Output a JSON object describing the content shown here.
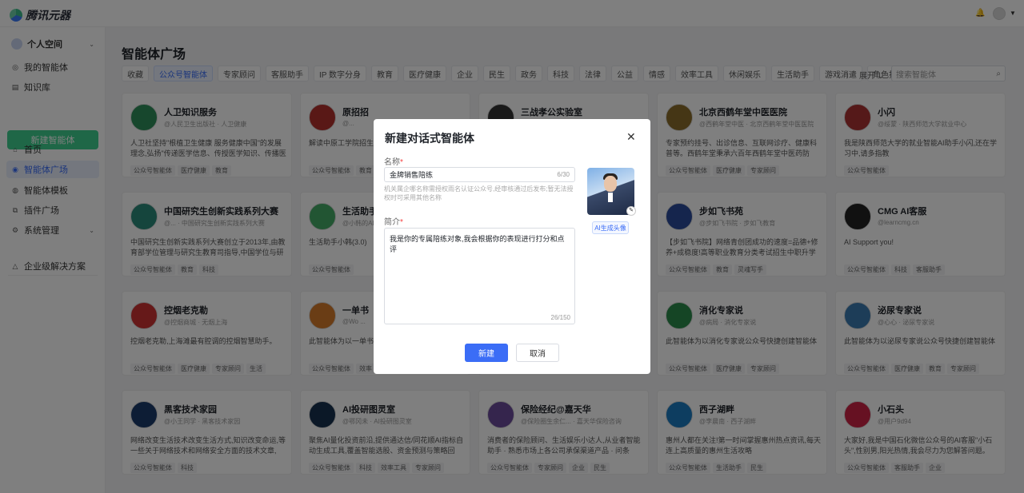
{
  "app": {
    "name": "腾讯元器"
  },
  "sidebar": {
    "workspace": "个人空间",
    "items": [
      {
        "label": "我的智能体"
      },
      {
        "label": "知识库"
      },
      {
        "label": "首页"
      },
      {
        "label": "智能体广场"
      },
      {
        "label": "智能体模板"
      },
      {
        "label": "插件广场"
      },
      {
        "label": "系统管理"
      },
      {
        "label": "企业级解决方案"
      }
    ],
    "new_agent_label": "新建智能体"
  },
  "main": {
    "title": "智能体广场",
    "tags": [
      "收藏",
      "公众号智能体",
      "专家顾问",
      "客服助手",
      "IP 数字分身",
      "教育",
      "医疗健康",
      "企业",
      "民生",
      "政务",
      "科技",
      "法律",
      "公益",
      "情感",
      "效率工具",
      "休闲娱乐",
      "生活助手",
      "游戏消遣",
      "角色扮演"
    ],
    "active_tag": "公众号智能体",
    "expand_label": "展开",
    "search_placeholder": "搜索智能体"
  },
  "cards": [
    {
      "name": "人卫知识服务",
      "meta": "@人民卫生出版社 · 人卫健康",
      "desc": "人卫社坚持\"根植卫生健康 服务健康中国\"的发展理念,弘扬\"传递医学信息、传授医学知识、传播医学...",
      "tags": [
        "公众号智能体",
        "医疗健康",
        "教育"
      ]
    },
    {
      "name": "原招招",
      "meta": "@...",
      "desc": "解读中原工学院招生政策...",
      "tags": [
        "公众号智能体",
        "教育"
      ]
    },
    {
      "name": "三战孝公实验室",
      "meta": "",
      "desc": "",
      "tags": []
    },
    {
      "name": "北京西鹤年堂中医医院",
      "meta": "@西鹤年堂中医 · 北京西鹤年堂中医医院",
      "desc": "专家预约挂号、出诊信息、互联网诊疗、健康科普等。西鹤年堂秉承六百年西鹤年堂中医药防病、治...",
      "tags": [
        "公众号智能体",
        "医疗健康",
        "专家顾问"
      ]
    },
    {
      "name": "小闪",
      "meta": "@绥蒙 · 陕西师范大学就业中心",
      "desc": "我是陕西师范大学的就业智能AI助手小闪,还在学习中,请多指教",
      "tags": [
        "公众号智能体"
      ]
    },
    {
      "name": "中国研究生创新实践系列大赛",
      "meta": "@... · 中国研究生创新实践系列大赛",
      "desc": "中国研究生创新实践系列大赛创立于2013年,由教育部学位管理与研究生教育司指导,中国学位与研究生教...",
      "tags": [
        "公众号智能体",
        "教育",
        "科技"
      ]
    },
    {
      "name": "生活助手",
      "meta": "@小韩的AI...",
      "desc": "生活助手小韩(3.0)",
      "tags": [
        "公众号智能体"
      ]
    },
    {
      "name": "",
      "meta": "",
      "desc": "",
      "tags": []
    },
    {
      "name": "步如飞书苑",
      "meta": "@步如飞书院 · 步如飞教育",
      "desc": "【步如飞书院】网络青创团成功的速度=品德+修养+成稳度!高等职业教育分类考试招生中职升学考试...",
      "tags": [
        "公众号智能体",
        "教育",
        "灵魂写手"
      ]
    },
    {
      "name": "CMG AI客服",
      "meta": "@learncmg.cn",
      "desc": "AI Support you!",
      "tags": [
        "公众号智能体",
        "科技",
        "客服助手"
      ]
    },
    {
      "name": "控烟老克勒",
      "meta": "@控烟商城 · 无烟上海",
      "desc": "控烟老克勒,上海滩最有腔调的控烟智慧助手。",
      "tags": [
        "公众号智能体",
        "医疗健康",
        "专家顾问",
        "生活"
      ]
    },
    {
      "name": "一单书",
      "meta": "@Wo ...",
      "desc": "此智能体为以一单书公...",
      "tags": [
        "公众号智能体",
        "效率"
      ]
    },
    {
      "name": "",
      "meta": "",
      "desc": "",
      "tags": []
    },
    {
      "name": "消化专家说",
      "meta": "@病局 · 消化专家说",
      "desc": "此智能体为以消化专家说公众号快捷创建智能体",
      "tags": [
        "公众号智能体",
        "医疗健康",
        "专家顾问"
      ]
    },
    {
      "name": "泌尿专家说",
      "meta": "@心心 · 泌尿专家说",
      "desc": "此智能体为以泌尿专家说公众号快捷创建智能体",
      "tags": [
        "公众号智能体",
        "医疗健康",
        "教育",
        "专家顾问"
      ]
    },
    {
      "name": "黑客技术家园",
      "meta": "@小王同学 · 黑客技术家园",
      "desc": "网络改变生活技术改变生活方式,知识改变命运,等一些关于网络技术和网络安全方面的技术文章,为...",
      "tags": [
        "公众号智能体",
        "科技"
      ]
    },
    {
      "name": "AI投研图灵室",
      "meta": "@鄂冈未 · AI投研图灵室",
      "desc": "聚焦AI量化投资前沿,提供通达信/同花顺AI指标自动生成工具,覆盖智能选股、资金预测与策略回测。...",
      "tags": [
        "公众号智能体",
        "科技",
        "效率工具",
        "专家顾问"
      ]
    },
    {
      "name": "保险经纪@嘉天华",
      "meta": "@保险圈生余仁... · 嘉天华保险咨询",
      "desc": "消费者的保险顾问、生活娱乐小达人,从业者智能助手 · 熟悉市场上各公司承保渠道产品 · 问条款、问评...",
      "tags": [
        "公众号智能体",
        "专家顾问",
        "企业",
        "民生"
      ]
    },
    {
      "name": "西子湖畔",
      "meta": "@李晨南 · 西子湖畔",
      "desc": "惠州人都在关注!第一时间掌握惠州热点资讯,每天连上高质量的惠州生活攻略",
      "tags": [
        "公众号智能体",
        "生活助手",
        "民生"
      ]
    },
    {
      "name": "小石头",
      "meta": "@用户9d94",
      "desc": "大家好,我是中国石化微信公众号的AI客服\"小石头\",性别男,阳光热情,我会尽力为您解答问题。",
      "tags": [
        "公众号智能体",
        "客服助手",
        "企业"
      ]
    }
  ],
  "modal": {
    "title": "新建对话式智能体",
    "name_label": "名称",
    "name_value": "金牌销售陪练",
    "name_count": "6/30",
    "name_hint": "机关属企哪名称需授权雨名认证公众号,经审核通过后发布;暂无法授权时可采用其他名称",
    "ai_avatar_label": "AI生成头像",
    "intro_label": "简介",
    "intro_value": "我是你的专属陪练对象,我会根据你的表现进行打分和点评",
    "intro_count": "26/150",
    "submit_label": "新建",
    "cancel_label": "取消"
  },
  "colors": {
    "primary": "#3b6df6",
    "new_agent_btn": "#3ecf8e",
    "overlay": "rgba(0,0,0,0.5)"
  }
}
